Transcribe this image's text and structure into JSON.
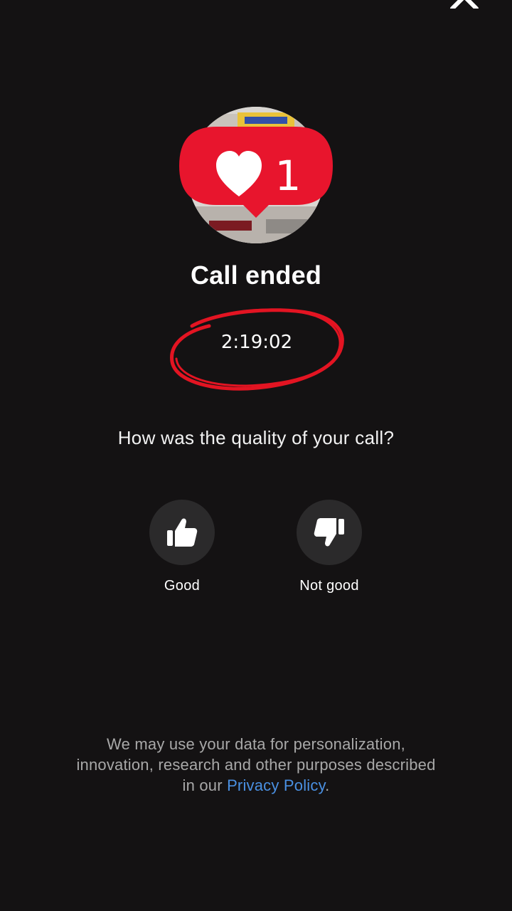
{
  "header": {
    "close_icon": "close-icon"
  },
  "avatar": {
    "like_icon": "heart-icon",
    "like_count": "1"
  },
  "call": {
    "title": "Call ended",
    "duration": "2:19:02"
  },
  "feedback": {
    "question": "How was the quality of your call?",
    "good_label": "Good",
    "good_icon": "thumbs-up-icon",
    "bad_label": "Not good",
    "bad_icon": "thumbs-down-icon"
  },
  "footer": {
    "text_line1": "We may use your data for personalization,",
    "text_line2": "innovation, research and other purposes described",
    "text_prefix": "in our ",
    "link": "Privacy Policy",
    "text_suffix": "."
  },
  "colors": {
    "background": "#141213",
    "accent_link": "#4a90e2",
    "badge_red": "#e8152d",
    "annotation_red": "#e31422",
    "button_bg": "#2b2a2b"
  }
}
